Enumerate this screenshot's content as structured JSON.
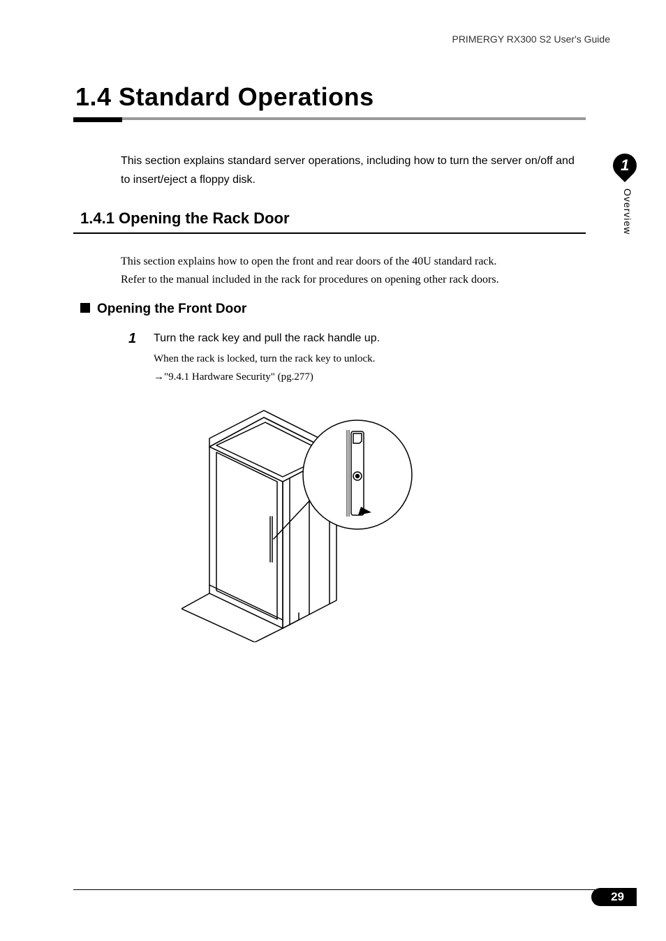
{
  "header": {
    "doc_title": "PRIMERGY RX300 S2 User's Guide"
  },
  "main": {
    "heading": "1.4  Standard Operations",
    "intro": "This section explains standard server operations, including how to turn the server on/off and to insert/eject a floppy disk."
  },
  "section": {
    "heading": "1.4.1  Opening the Rack Door",
    "body_line1": "This section explains how to open the front and rear doors of the 40U standard rack.",
    "body_line2": " Refer to the manual included in the rack for procedures on opening other rack doors."
  },
  "subsection": {
    "heading": "Opening the Front Door"
  },
  "step": {
    "number": "1",
    "text": "Turn the rack key and pull the rack handle up.",
    "detail_line1": "When the rack is locked, turn the rack key to unlock.",
    "detail_line2": "→\"9.4.1 Hardware Security\" (pg.277)"
  },
  "sidebar": {
    "chapter_num": "1",
    "chapter_name": "Overview"
  },
  "footer": {
    "page": "29"
  }
}
